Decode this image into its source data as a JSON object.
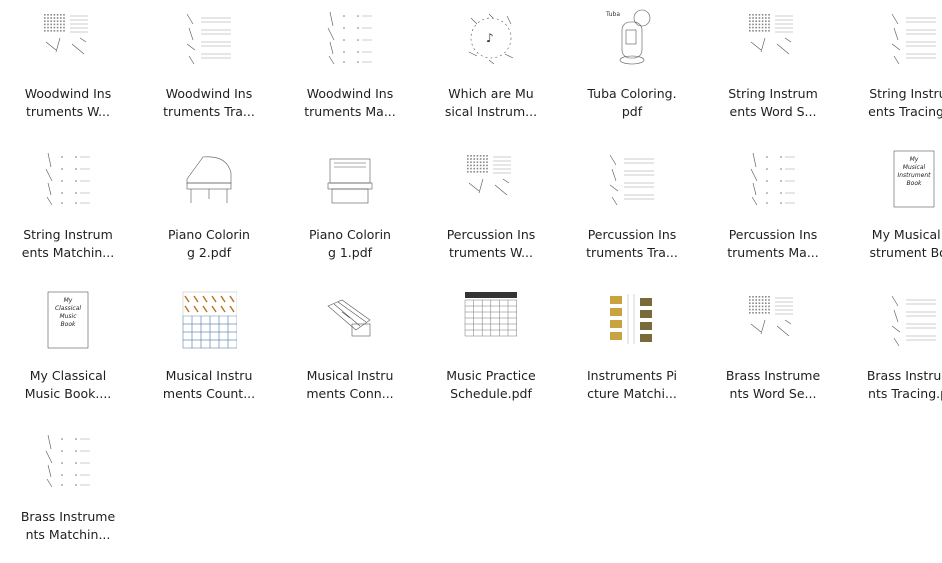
{
  "files": [
    {
      "line1": "Woodwind Ins",
      "line2": "truments W...",
      "thumb": "wordsearch-icon"
    },
    {
      "line1": "Woodwind Ins",
      "line2": "truments Tra...",
      "thumb": "tracing-icon"
    },
    {
      "line1": "Woodwind Ins",
      "line2": "truments Ma...",
      "thumb": "matching-icon"
    },
    {
      "line1": "Which are Mu",
      "line2": "sical Instrum...",
      "thumb": "instrument-circle-icon"
    },
    {
      "line1": "Tuba Coloring.",
      "line2": "pdf",
      "thumb": "tuba-icon",
      "thumb_text": "Tuba"
    },
    {
      "line1": "String Instrum",
      "line2": "ents Word S...",
      "thumb": "wordsearch-icon"
    },
    {
      "line1": "String Instrum",
      "line2": "ents Tracing ...",
      "thumb": "tracing-icon"
    },
    {
      "line1": "String Instrum",
      "line2": "ents Matchin...",
      "thumb": "matching-icon"
    },
    {
      "line1": "Piano Colorin",
      "line2": "g 2.pdf",
      "thumb": "grand-piano-icon"
    },
    {
      "line1": "Piano Colorin",
      "line2": "g 1.pdf",
      "thumb": "upright-piano-icon"
    },
    {
      "line1": "Percussion Ins",
      "line2": "truments W...",
      "thumb": "wordsearch-icon"
    },
    {
      "line1": "Percussion Ins",
      "line2": "truments Tra...",
      "thumb": "tracing-icon"
    },
    {
      "line1": "Percussion Ins",
      "line2": "truments Ma...",
      "thumb": "matching-icon"
    },
    {
      "line1": "My Musical In",
      "line2": "strument Bo...",
      "thumb": "book-cover-icon",
      "thumb_text": "My Musical Instrument Book"
    },
    {
      "line1": "My Classical",
      "line2": "Music Book....",
      "thumb": "book-cover-icon",
      "thumb_text": "My Classical Music Book"
    },
    {
      "line1": "Musical Instru",
      "line2": "ments Count...",
      "thumb": "counting-grid-icon"
    },
    {
      "line1": "Musical Instru",
      "line2": "ments Conn...",
      "thumb": "accordion-icon"
    },
    {
      "line1": "Music Practice",
      "line2": "Schedule.pdf",
      "thumb": "schedule-icon"
    },
    {
      "line1": "Instruments Pi",
      "line2": "cture Matchi...",
      "thumb": "picture-matching-icon"
    },
    {
      "line1": "Brass Instrume",
      "line2": "nts Word Se...",
      "thumb": "wordsearch-icon"
    },
    {
      "line1": "Brass Instrume",
      "line2": "nts Tracing.p...",
      "thumb": "tracing-icon"
    },
    {
      "line1": "Brass Instrume",
      "line2": "nts Matchin...",
      "thumb": "matching-icon"
    }
  ]
}
